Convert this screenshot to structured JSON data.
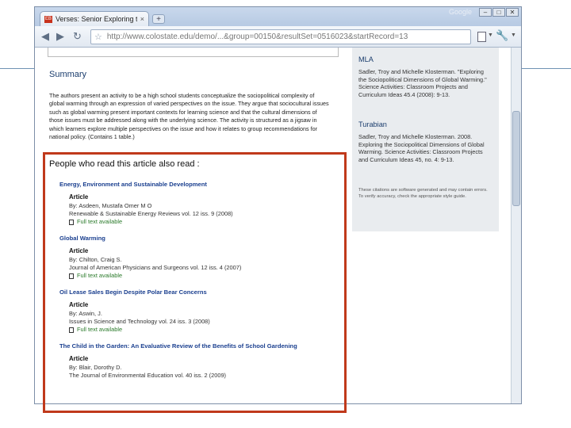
{
  "browser": {
    "tab_title": "Verses: Senior Exploring th",
    "tab_favicon": "EB",
    "tab_close": "×",
    "new_tab": "+",
    "brand": "Google",
    "url": "http://www.colostate.edu/demo/...&group=00150&resultSet=0516023&startRecord=13",
    "window_buttons": [
      "–",
      "□",
      "✕"
    ]
  },
  "main": {
    "summary_heading": "Summary",
    "summary_text": "The authors present an activity to be a high school students conceptualize the sociopolitical complexity of global warming through an expression of varied perspectives on the issue. They argue that sociocultural issues such as global warming present important contexts for learning science and that the cultural dimensions of those issues must be addressed along with the underlying science. The activity is structured as a jigsaw in which learners explore multiple perspectives on the issue and how it relates to group recommendations for national policy. (Contains 1 table.)",
    "people_heading": "People who read this article also read :",
    "recommendations": [
      {
        "title": "Energy, Environment and Sustainable Development",
        "type": "Article",
        "author": "By: Asdeen, Mustafa Omer M O",
        "source": "Renewable & Sustainable Energy Reviews vol. 12 iss. 9 (2008)",
        "fulltext": "Full text available"
      },
      {
        "title": "Global Warming",
        "type": "Article",
        "author": "By: Chilton, Craig S.",
        "source": "Journal of American Physicians and Surgeons vol. 12 iss. 4 (2007)",
        "fulltext": "Full text available"
      },
      {
        "title": "Oil Lease Sales Begin Despite Polar Bear Concerns",
        "type": "Article",
        "author": "By: Aswin, J.",
        "source": "Issues in Science and Technology vol. 24 iss. 3 (2008)",
        "fulltext": "Full text available"
      },
      {
        "title": "The Child in the Garden: An Evaluative Review of the Benefits of School Gardening",
        "type": "Article",
        "author": "By: Blair, Dorothy D.",
        "source": "The Journal of Environmental Education vol. 40 iss. 2 (2009)",
        "fulltext": ""
      }
    ]
  },
  "citations": {
    "mla_heading": "MLA",
    "mla_text": "Sadler, Troy and Michelle Klosterman. \"Exploring the Sociopolitical Dimensions of Global Warming.\" Science Activities: Classroom Projects and Curriculum Ideas 45.4 (2008): 9-13.",
    "turabian_heading": "Turabian",
    "turabian_text": "Sadler, Troy and Michelle Klosterman. 2008. Exploring the Sociopolitical Dimensions of Global Warming. Science Activities: Classroom Projects and Curriculum Ideas 45, no. 4: 9-13.",
    "note": "These citations are software generated and may contain errors. To verify accuracy, check the appropriate style guide."
  }
}
